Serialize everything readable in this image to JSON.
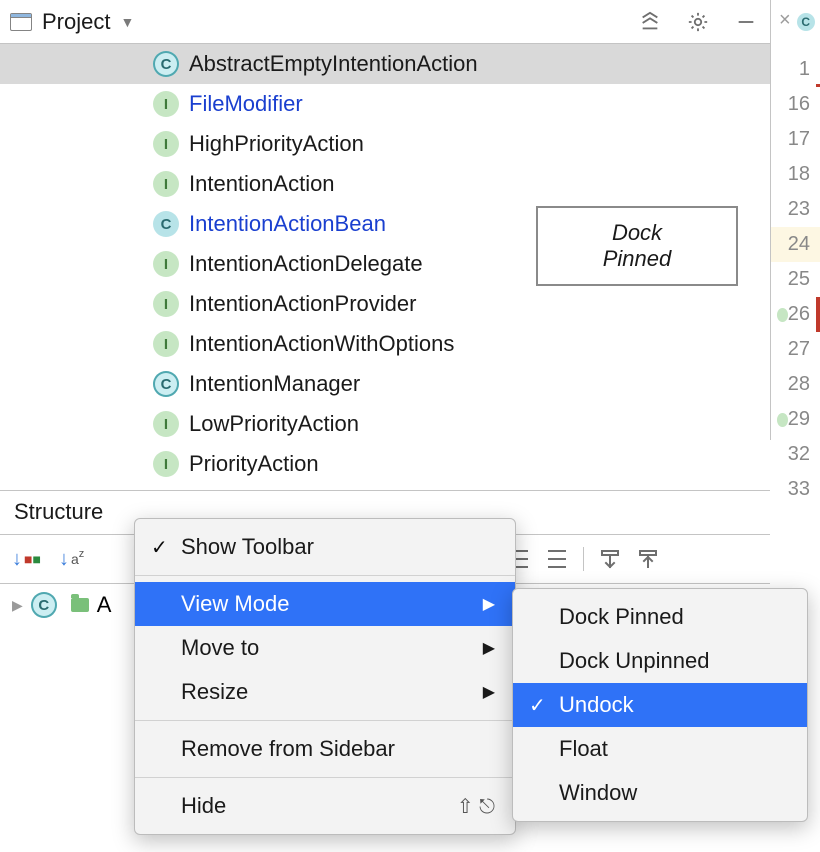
{
  "toolbar": {
    "title": "Project"
  },
  "tooltip": {
    "line1": "Dock",
    "line2": "Pinned"
  },
  "tree": {
    "items": [
      {
        "kind": "C",
        "kindStyle": "ring",
        "label": "AbstractEmptyIntentionAction",
        "selected": true,
        "link": false
      },
      {
        "kind": "I",
        "kindStyle": "",
        "label": "FileModifier",
        "selected": false,
        "link": true
      },
      {
        "kind": "I",
        "kindStyle": "",
        "label": "HighPriorityAction",
        "selected": false,
        "link": false
      },
      {
        "kind": "I",
        "kindStyle": "",
        "label": "IntentionAction",
        "selected": false,
        "link": false
      },
      {
        "kind": "C",
        "kindStyle": "",
        "label": "IntentionActionBean",
        "selected": false,
        "link": true
      },
      {
        "kind": "I",
        "kindStyle": "",
        "label": "IntentionActionDelegate",
        "selected": false,
        "link": false
      },
      {
        "kind": "I",
        "kindStyle": "",
        "label": "IntentionActionProvider",
        "selected": false,
        "link": false
      },
      {
        "kind": "I",
        "kindStyle": "",
        "label": "IntentionActionWithOptions",
        "selected": false,
        "link": false
      },
      {
        "kind": "C",
        "kindStyle": "ring",
        "label": "IntentionManager",
        "selected": false,
        "link": false
      },
      {
        "kind": "I",
        "kindStyle": "",
        "label": "LowPriorityAction",
        "selected": false,
        "link": false
      },
      {
        "kind": "I",
        "kindStyle": "",
        "label": "PriorityAction",
        "selected": false,
        "link": false
      }
    ]
  },
  "gutter": {
    "lines": [
      "1",
      "16",
      "17",
      "18",
      "23",
      "24",
      "25",
      "26",
      "27",
      "28",
      "29",
      "32",
      "33"
    ],
    "highlightIndex": 5
  },
  "structure": {
    "title": "Structure",
    "rowPrefix": "A"
  },
  "menu": {
    "items": [
      {
        "label": "Show Toolbar",
        "checked": true
      },
      {
        "label": "View Mode",
        "submenu": true,
        "highlight": true
      },
      {
        "label": "Move to",
        "submenu": true
      },
      {
        "label": "Resize",
        "submenu": true
      },
      {
        "label": "Remove from Sidebar"
      },
      {
        "label": "Hide",
        "shortcut": "⇧ ⎋"
      }
    ],
    "seps": [
      0,
      3,
      4
    ]
  },
  "submenu": {
    "items": [
      {
        "label": "Dock Pinned"
      },
      {
        "label": "Dock Unpinned"
      },
      {
        "label": "Undock",
        "checked": true,
        "highlight": true
      },
      {
        "label": "Float"
      },
      {
        "label": "Window"
      }
    ]
  }
}
